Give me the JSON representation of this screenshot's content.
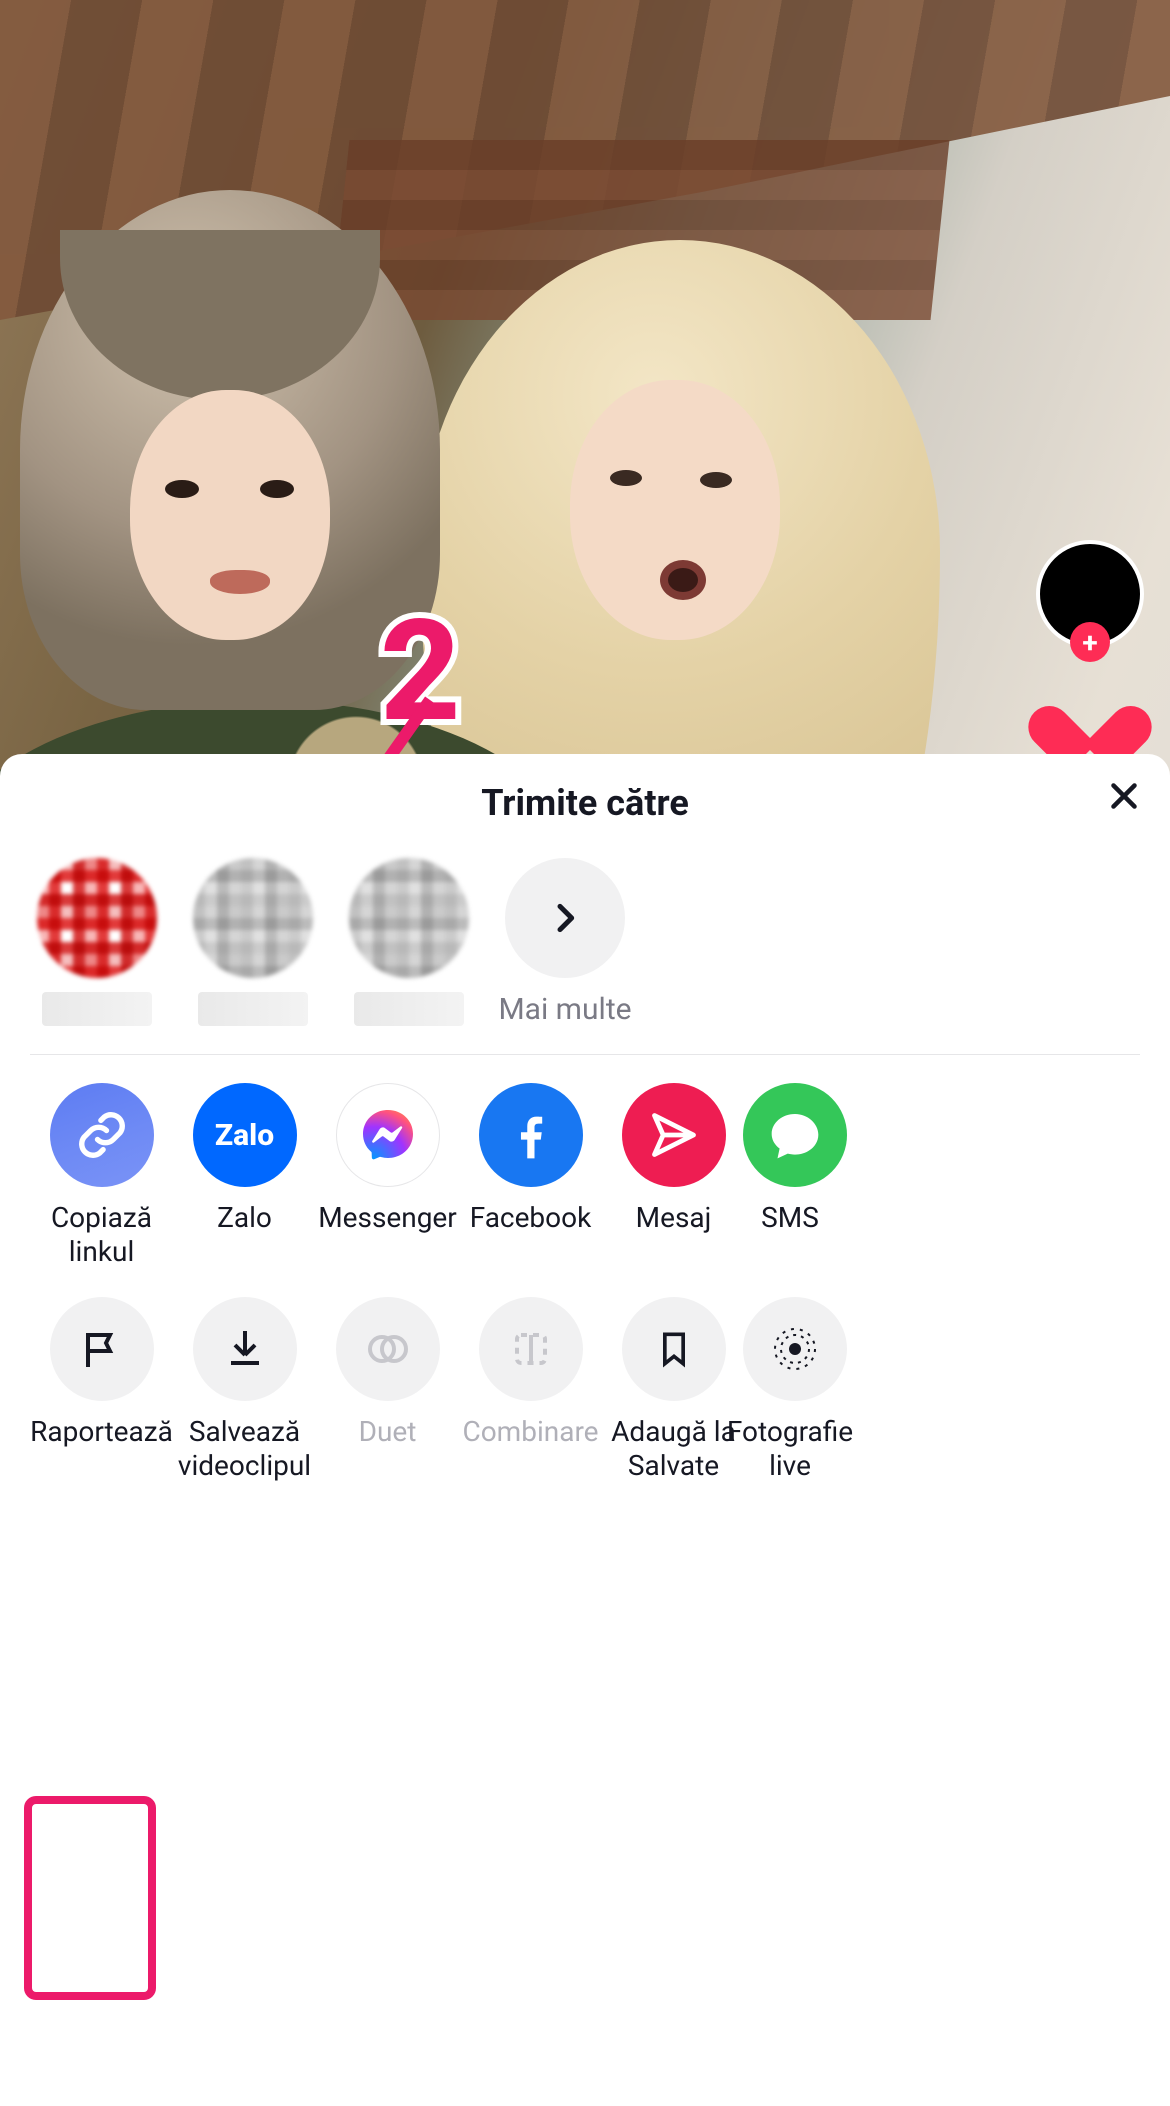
{
  "annotation": {
    "step_number": "2"
  },
  "video_rail": {
    "follow_icon": "plus-icon"
  },
  "sheet": {
    "title": "Trimite către",
    "close_icon": "close-icon",
    "people": {
      "more_label": "Mai multe"
    },
    "share_options": [
      {
        "id": "copy-link",
        "label": "Copiază linkul",
        "color": "#6480f4"
      },
      {
        "id": "zalo",
        "label": "Zalo",
        "color": "#0068ff",
        "text": "Zalo"
      },
      {
        "id": "messenger",
        "label": "Messenger",
        "color": "#ffffff"
      },
      {
        "id": "facebook",
        "label": "Facebook",
        "color": "#1877f2"
      },
      {
        "id": "mesaj",
        "label": "Mesaj",
        "color": "#ee1d52"
      },
      {
        "id": "sms",
        "label": "SMS",
        "color": "#34c759"
      }
    ],
    "action_options": [
      {
        "id": "report",
        "label": "Raportează",
        "enabled": true
      },
      {
        "id": "save",
        "label": "Salvează videoclipul",
        "enabled": true
      },
      {
        "id": "duet",
        "label": "Duet",
        "enabled": false
      },
      {
        "id": "stitch",
        "label": "Combinare",
        "enabled": false
      },
      {
        "id": "favorite",
        "label": "Adaugă la Salvate",
        "enabled": true
      },
      {
        "id": "live-photo",
        "label": "Fotografie live",
        "enabled": true
      }
    ]
  }
}
